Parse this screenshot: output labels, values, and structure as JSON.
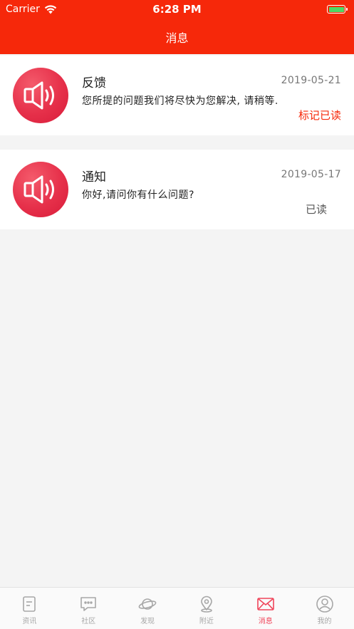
{
  "status_bar": {
    "carrier": "Carrier",
    "time": "6:28 PM"
  },
  "header": {
    "title": "消息"
  },
  "messages": [
    {
      "title": "反馈",
      "date": "2019-05-21",
      "body": "您所提的问题我们将尽快为您解决, 请稍等.",
      "status": "标记已读",
      "unread": true
    },
    {
      "title": "通知",
      "date": "2019-05-17",
      "body": "你好,请问你有什么问题?",
      "status": "已读",
      "unread": false
    }
  ],
  "tabbar": {
    "items": [
      {
        "label": "资讯",
        "icon": "news-icon"
      },
      {
        "label": "社区",
        "icon": "chat-icon"
      },
      {
        "label": "发现",
        "icon": "planet-icon"
      },
      {
        "label": "附近",
        "icon": "location-icon"
      },
      {
        "label": "消息",
        "icon": "envelope-icon",
        "active": true
      },
      {
        "label": "我的",
        "icon": "user-icon"
      }
    ]
  },
  "colors": {
    "brand": "#f6280a",
    "active_tab": "#f0455a",
    "icon_gradient": "#e6304a"
  }
}
